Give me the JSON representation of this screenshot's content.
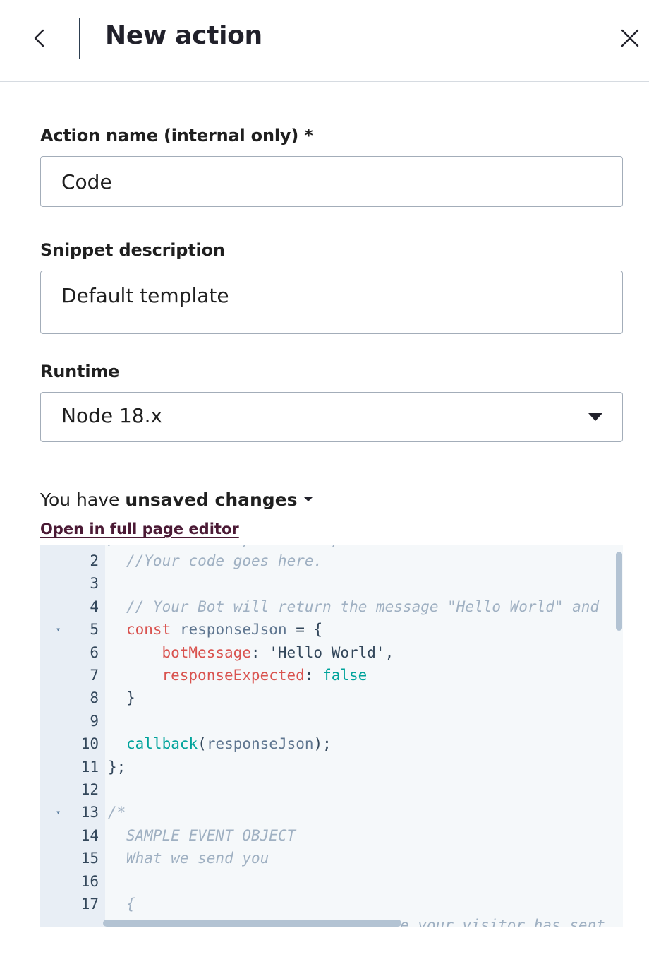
{
  "header": {
    "title": "New action"
  },
  "form": {
    "action_name": {
      "label": "Action name (internal only) *",
      "value": "Code"
    },
    "snippet_description": {
      "label": "Snippet description",
      "value": "Default template"
    },
    "runtime": {
      "label": "Runtime",
      "value": "Node 18.x"
    }
  },
  "editor_status": {
    "prefix": "You have ",
    "bold": "unsaved changes",
    "open_link": "Open in full page editor"
  },
  "code_editor": {
    "partial_top": "/ ...      .   ,      .  ,   ",
    "partial_bottom": "e your visitor has sent",
    "lines": [
      {
        "n": "2",
        "fold": "",
        "text": "  //Your code goes here."
      },
      {
        "n": "3",
        "fold": "",
        "text": ""
      },
      {
        "n": "4",
        "fold": "",
        "text": "  // Your Bot will return the message \"Hello World\" and"
      },
      {
        "n": "5",
        "fold": "▾",
        "text": "  const responseJson = {"
      },
      {
        "n": "6",
        "fold": "",
        "text": "    botMessage: 'Hello World',"
      },
      {
        "n": "7",
        "fold": "",
        "text": "    responseExpected: false"
      },
      {
        "n": "8",
        "fold": "",
        "text": "  }"
      },
      {
        "n": "9",
        "fold": "",
        "text": ""
      },
      {
        "n": "10",
        "fold": "",
        "text": "  callback(responseJson);"
      },
      {
        "n": "11",
        "fold": "",
        "text": "};"
      },
      {
        "n": "12",
        "fold": "",
        "text": ""
      },
      {
        "n": "13",
        "fold": "▾",
        "text": "/*"
      },
      {
        "n": "14",
        "fold": "",
        "text": "  SAMPLE EVENT OBJECT"
      },
      {
        "n": "15",
        "fold": "",
        "text": "  What we send you"
      },
      {
        "n": "16",
        "fold": "",
        "text": ""
      },
      {
        "n": "17",
        "fold": "",
        "text": "  {"
      }
    ]
  }
}
